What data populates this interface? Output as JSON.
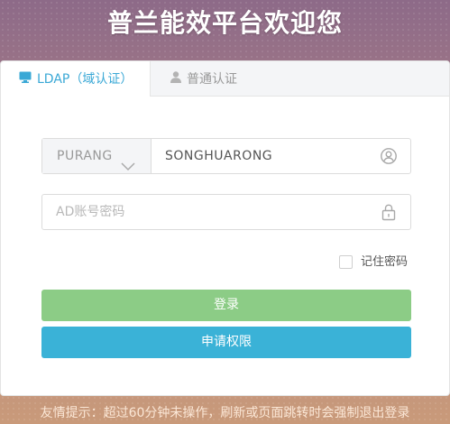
{
  "page": {
    "title": "普兰能效平台欢迎您"
  },
  "tabs": [
    {
      "label": "LDAP（域认证）",
      "icon": "monitor-icon",
      "active": true
    },
    {
      "label": "普通认证",
      "icon": "user-icon",
      "active": false
    }
  ],
  "form": {
    "domain": {
      "value": "PURANG",
      "icon": "chevron-down-icon"
    },
    "username": {
      "value": "SONGHUARONG",
      "icon": "user-circle-icon"
    },
    "password": {
      "placeholder": "AD账号密码",
      "icon": "lock-icon"
    },
    "remember": {
      "label": "记住密码",
      "checked": false
    }
  },
  "buttons": {
    "login": "登录",
    "apply": "申请权限"
  },
  "tip": "友情提示：超过60分钟未操作，刷新或页面跳转时会强制退出登录",
  "colors": {
    "active_tab": "#3aa8d6",
    "login_button": "#8ccc86",
    "apply_button": "#3ab2d7"
  }
}
